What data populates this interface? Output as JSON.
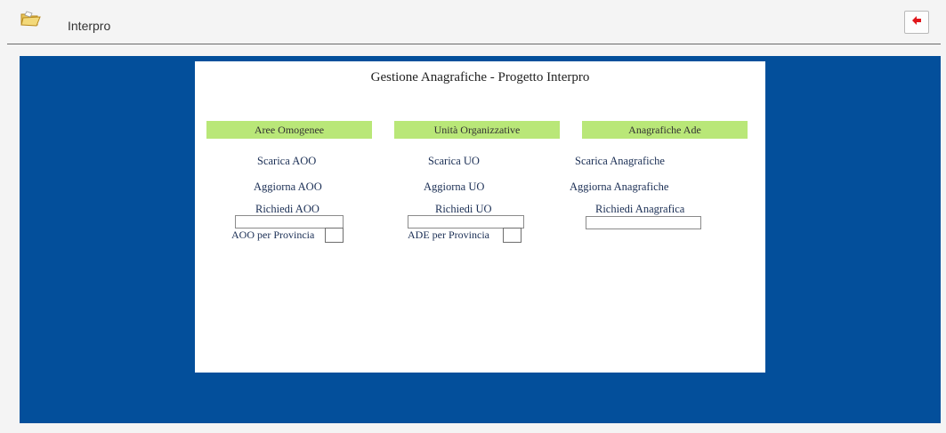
{
  "window": {
    "title": "Interpro",
    "icon": "folder-open-icon",
    "exit_icon": "exit-icon"
  },
  "colors": {
    "background": "#034f9b",
    "section_header": "#b9e778",
    "link": "#1b2f55",
    "exit_arrow": "#e0161b"
  },
  "panel": {
    "title": "Gestione Anagrafiche - Progetto Interpro"
  },
  "sections": {
    "aoo": {
      "header": "Aree Omogenee",
      "scarica": "Scarica AOO",
      "aggiorna": "Aggiorna AOO",
      "richiedi": "Richiedi AOO",
      "input_value": "",
      "checkbox_label": "AOO per Provincia"
    },
    "uo": {
      "header": "Unità Organizzative",
      "scarica": "Scarica UO",
      "aggiorna": "Aggiorna UO",
      "richiedi": "Richiedi UO",
      "input_value": "",
      "checkbox_label": "ADE per Provincia"
    },
    "ade": {
      "header": "Anagrafiche Ade",
      "scarica": "Scarica Anagrafiche",
      "aggiorna": "Aggiorna Anagrafiche",
      "richiedi": "Richiedi Anagrafica",
      "input_value": ""
    }
  }
}
